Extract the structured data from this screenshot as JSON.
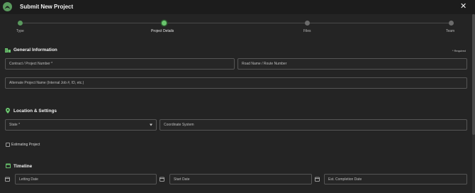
{
  "header": {
    "title": "Submit New Project",
    "close_icon": "close-icon"
  },
  "steps": [
    {
      "label": "Type",
      "state": "done"
    },
    {
      "label": "Project Details",
      "state": "active"
    },
    {
      "label": "Files",
      "state": "todo"
    },
    {
      "label": "Team",
      "state": "todo"
    }
  ],
  "general": {
    "title": "General Information",
    "required_note": "* Required",
    "contract_placeholder": "Contract / Project Number *",
    "road_placeholder": "Road Name / Route Number",
    "alt_name_placeholder": "Alternate Project Name (Internal Job #, ID, etc.)"
  },
  "location": {
    "title": "Location & Settings",
    "state_placeholder": "State *",
    "coordinate_placeholder": "Coordinate System",
    "estimating_label": "Estimating Project"
  },
  "timeline": {
    "title": "Timeline",
    "letting_placeholder": "Letting Date",
    "start_placeholder": "Start Date",
    "completion_placeholder": "Est. Completion Date"
  },
  "colors": {
    "accent": "#6ac56e",
    "background": "#242424",
    "field_border": "#555555"
  }
}
